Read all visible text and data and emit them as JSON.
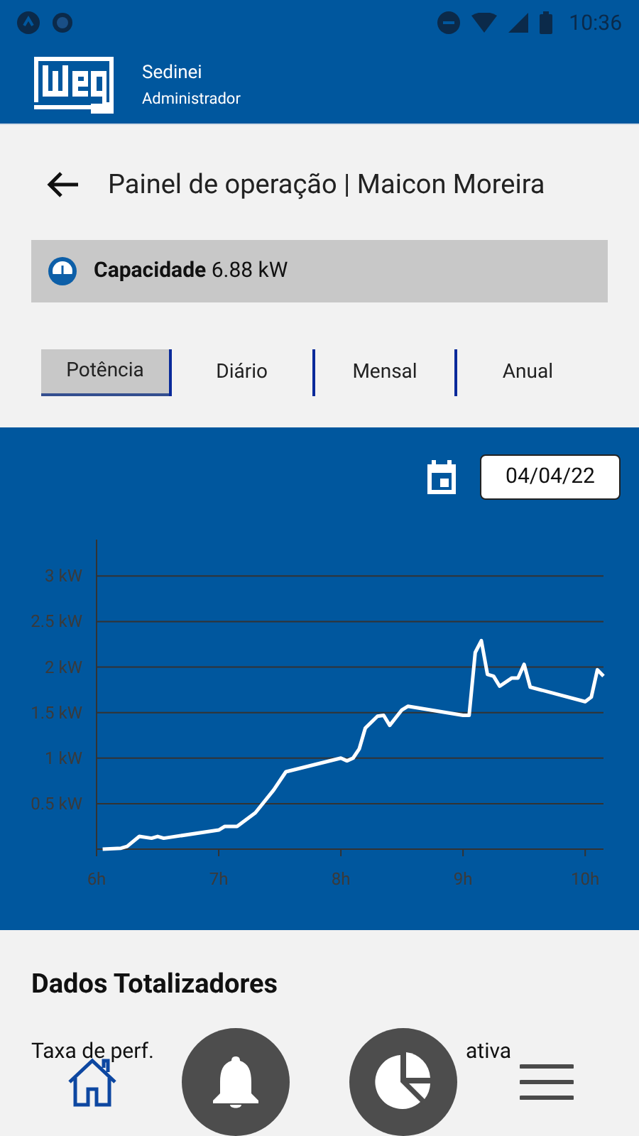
{
  "status_bar": {
    "time": "10:36"
  },
  "header": {
    "name": "Sedinei",
    "role": "Administrador"
  },
  "page": {
    "title": "Painel de operação | Maicon Moreira"
  },
  "capacity": {
    "label": "Capacidade",
    "value": "6.88 kW"
  },
  "tabs": [
    {
      "label": "Potência",
      "selected": true
    },
    {
      "label": "Diário",
      "selected": false
    },
    {
      "label": "Mensal",
      "selected": false
    },
    {
      "label": "Anual",
      "selected": false
    }
  ],
  "date": "04/04/22",
  "chart_data": {
    "type": "line",
    "grid": true,
    "xlim": [
      6,
      10.15
    ],
    "ylim": [
      0,
      3.4
    ],
    "xticks": [
      {
        "value": 6,
        "label": "6h"
      },
      {
        "value": 7,
        "label": "7h"
      },
      {
        "value": 8,
        "label": "8h"
      },
      {
        "value": 9,
        "label": "9h"
      },
      {
        "value": 10,
        "label": "10h"
      }
    ],
    "yticks": [
      {
        "value": 0.5,
        "label": "0.5 kW"
      },
      {
        "value": 1,
        "label": "1 kW"
      },
      {
        "value": 1.5,
        "label": "1.5 kW"
      },
      {
        "value": 2,
        "label": "2 kW"
      },
      {
        "value": 2.5,
        "label": "2.5 kW"
      },
      {
        "value": 3,
        "label": "3 kW"
      }
    ],
    "x": [
      6.05,
      6.2,
      6.25,
      6.35,
      6.45,
      6.5,
      6.55,
      7.0,
      7.05,
      7.15,
      7.3,
      7.45,
      7.55,
      8.0,
      8.05,
      8.1,
      8.15,
      8.2,
      8.3,
      8.35,
      8.4,
      8.5,
      8.55,
      9.0,
      9.05,
      9.1,
      9.15,
      9.2,
      9.25,
      9.3,
      9.4,
      9.45,
      9.5,
      9.55,
      10.0,
      10.05,
      10.1,
      10.15
    ],
    "series": [
      {
        "color": "#ffffff",
        "values": [
          0.0,
          0.01,
          0.03,
          0.14,
          0.12,
          0.14,
          0.12,
          0.21,
          0.25,
          0.25,
          0.4,
          0.65,
          0.85,
          1.0,
          0.97,
          1.0,
          1.1,
          1.33,
          1.46,
          1.47,
          1.36,
          1.53,
          1.57,
          1.47,
          1.47,
          2.16,
          2.29,
          1.92,
          1.9,
          1.79,
          1.88,
          1.88,
          2.03,
          1.78,
          1.62,
          1.67,
          1.97,
          1.9
        ]
      }
    ]
  },
  "totals": {
    "title": "Dados Totalizadores",
    "items": [
      "Taxa de perf.",
      "ativa"
    ]
  },
  "nav": [
    {
      "kind": "home",
      "selected": true
    },
    {
      "kind": "bell",
      "selected": false
    },
    {
      "kind": "pie",
      "selected": false
    },
    {
      "kind": "menu",
      "selected": false
    }
  ]
}
